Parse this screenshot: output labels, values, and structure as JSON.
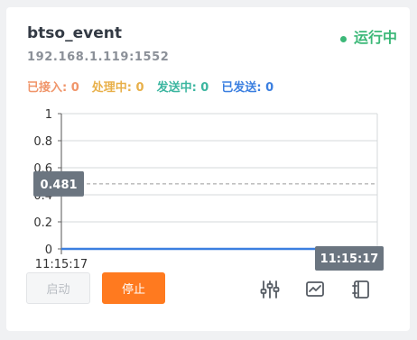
{
  "card": {
    "title": "btso_event",
    "address": "192.168.1.119:1552",
    "status_text": "运行中",
    "status_color": "#3cb878"
  },
  "counters": [
    {
      "label": "已接入:",
      "value": "0",
      "color": "#f0956a"
    },
    {
      "label": "处理中:",
      "value": "0",
      "color": "#e8b04a"
    },
    {
      "label": "发送中:",
      "value": "0",
      "color": "#3cb6a0"
    },
    {
      "label": "已发送:",
      "value": "0",
      "color": "#3b7fe0"
    }
  ],
  "chart_data": {
    "type": "line",
    "x": [
      "11:15:17"
    ],
    "series": [
      {
        "values": [
          0
        ],
        "color": "#3b7fe0"
      }
    ],
    "ylim": [
      0,
      1
    ],
    "yticks": [
      "0",
      "0.2",
      "0.4",
      "0.6",
      "0.8",
      "1"
    ],
    "xtick_label": "11:15:17",
    "grid": true,
    "crosshair": {
      "y_value": 0.481,
      "y_label": "0.481",
      "x_label": "11:15:17"
    }
  },
  "buttons": {
    "start_label": "启动",
    "stop_label": "停止"
  },
  "toolbar": {
    "icons": [
      "sliders-icon",
      "monitor-chart-icon",
      "log-notebook-icon"
    ]
  },
  "colors": {
    "accent_orange": "#ff7a1f",
    "line_blue": "#3b7fe0"
  }
}
